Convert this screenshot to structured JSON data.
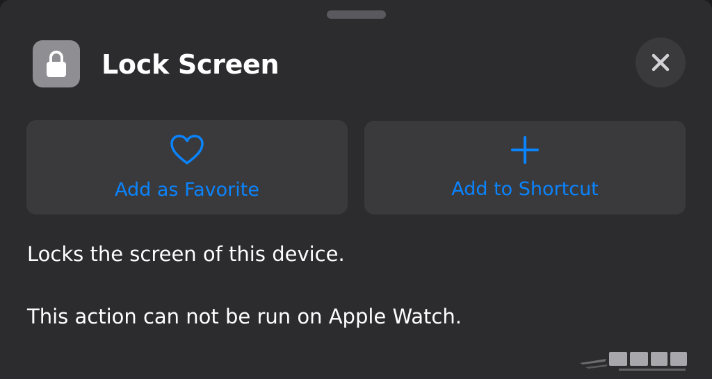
{
  "sheet": {
    "title": "Lock Screen",
    "app_icon": "lock-icon",
    "close_icon": "close-icon"
  },
  "actions": {
    "favorite": {
      "label": "Add as Favorite",
      "icon": "heart-icon"
    },
    "shortcut": {
      "label": "Add to Shortcut",
      "icon": "plus-icon"
    }
  },
  "description": {
    "line1": "Locks the screen of this device.",
    "line2": "This action can not be run on Apple Watch."
  },
  "colors": {
    "background": "#2c2c2e",
    "button": "#3a3a3c",
    "accent": "#0a84ff",
    "text": "#ffffff"
  }
}
